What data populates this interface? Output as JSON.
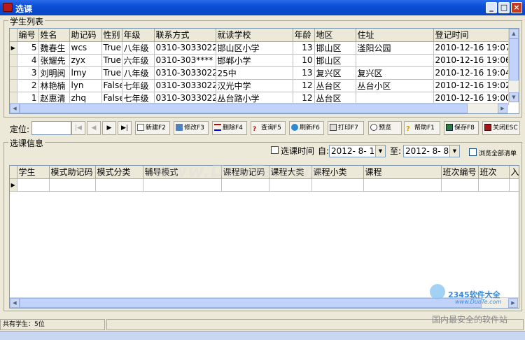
{
  "window": {
    "title": "选课",
    "min": "_",
    "max": "□",
    "close": "×"
  },
  "student_group": {
    "label": "学生列表",
    "columns": [
      "编号",
      "姓名",
      "助记码",
      "性别",
      "年级",
      "联系方式",
      "就读学校",
      "年龄",
      "地区",
      "住址",
      "登记时间"
    ],
    "rows": [
      [
        "5",
        "魏春生",
        "wcs",
        "True",
        "八年级",
        "0310-3033022",
        "邯山区小学",
        "13",
        "邯山区",
        "滏阳公园",
        "2010-12-16 19:07:5"
      ],
      [
        "4",
        "张耀先",
        "zyx",
        "True",
        "六年级",
        "0310-303****",
        "邯郸小学",
        "10",
        "邯山区",
        "",
        "2010-12-16 19:06:1"
      ],
      [
        "3",
        "刘明阅",
        "lmy",
        "True",
        "八年级",
        "0310-3033022",
        "25中",
        "13",
        "复兴区",
        "复兴区",
        "2010-12-16 19:04:4"
      ],
      [
        "2",
        "林艳楠",
        "lyn",
        "False",
        "七年级",
        "0310-3033022",
        "汉光中学",
        "12",
        "丛台区",
        "丛台小区",
        "2010-12-16 19:02:4"
      ],
      [
        "1",
        "赵惠清",
        "zhq",
        "False",
        "七年级",
        "0310-3033022",
        "丛台路小学",
        "12",
        "丛台区",
        "",
        "2010-12-16 19:00:2"
      ]
    ]
  },
  "toolbar": {
    "locate_label": "定位:",
    "nav_first": "|◀",
    "nav_prev": "◀",
    "nav_next": "▶",
    "nav_last": "▶|",
    "new": "新建F2",
    "edit": "修改F3",
    "delete": "删除F4",
    "query": "查询F5",
    "refresh": "刷新F6",
    "print": "打印F7",
    "preview": "预览",
    "help": "帮助F1",
    "save": "保存F8",
    "close": "关闭ESC"
  },
  "course_group": {
    "label": "选课信息",
    "time_label": "选课时间",
    "from_label": "自:",
    "from_value": "2012- 8- 1",
    "to_label": "至:",
    "to_value": "2012- 8- 8",
    "browse_label": "浏览全部清单",
    "columns": [
      "学生",
      "模式助记码",
      "模式分类",
      "辅导模式",
      "课程助记码",
      "课程大类",
      "课程小类",
      "课程",
      "班次编号",
      "班次",
      "入"
    ]
  },
  "status": {
    "text": "共有学生：5位"
  },
  "watermark": {
    "text": "www.DuoTe.com",
    "brand": "2345软件大全",
    "sub": "国内最安全的软件站",
    "url": "www.DuoTe.com"
  }
}
